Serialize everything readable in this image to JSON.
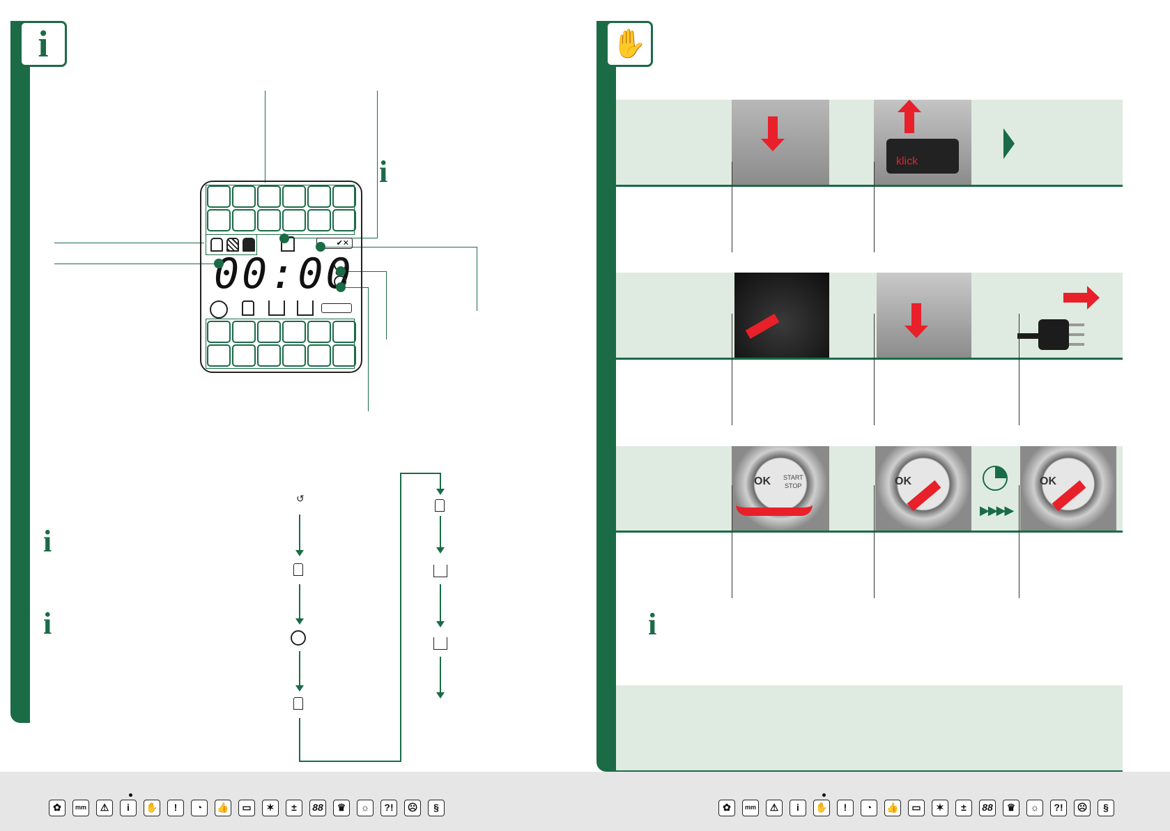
{
  "left_page": {
    "tab_icon": "info-icon",
    "lcd": {
      "time_display": "00:00",
      "check_cross": "✔✕"
    },
    "process_icons_col1": [
      "rotate-small-icon",
      "rest-icon",
      "knead-icon",
      "rise-icon"
    ],
    "process_icons_col2": [
      "rise-icon",
      "bake-icon",
      "keep-warm-icon"
    ]
  },
  "right_page": {
    "tab_icon": "hand-icon",
    "photo_labels": {
      "klick": "klick",
      "ok": "OK",
      "start": "START",
      "stop": "STOP"
    }
  },
  "footer_icons": [
    "flower-icon",
    "measure-icon",
    "warning-icon",
    "info-icon",
    "hand-icon",
    "exclamation-icon",
    "timer-icon",
    "thumbs-up-icon",
    "bread-maker-icon",
    "snowflake-icon",
    "plus-icon",
    "display-88-icon",
    "chef-hat-icon",
    "lightbulb-icon",
    "question-exclamation-icon",
    "sad-face-icon",
    "paragraph-icon"
  ],
  "footer_labels": [
    "mm",
    "i",
    "!",
    "88",
    "?!",
    "§"
  ],
  "colors": {
    "brand_green": "#1a6b46",
    "panel": "#dfebe1",
    "arrow_red": "#e8202a"
  }
}
